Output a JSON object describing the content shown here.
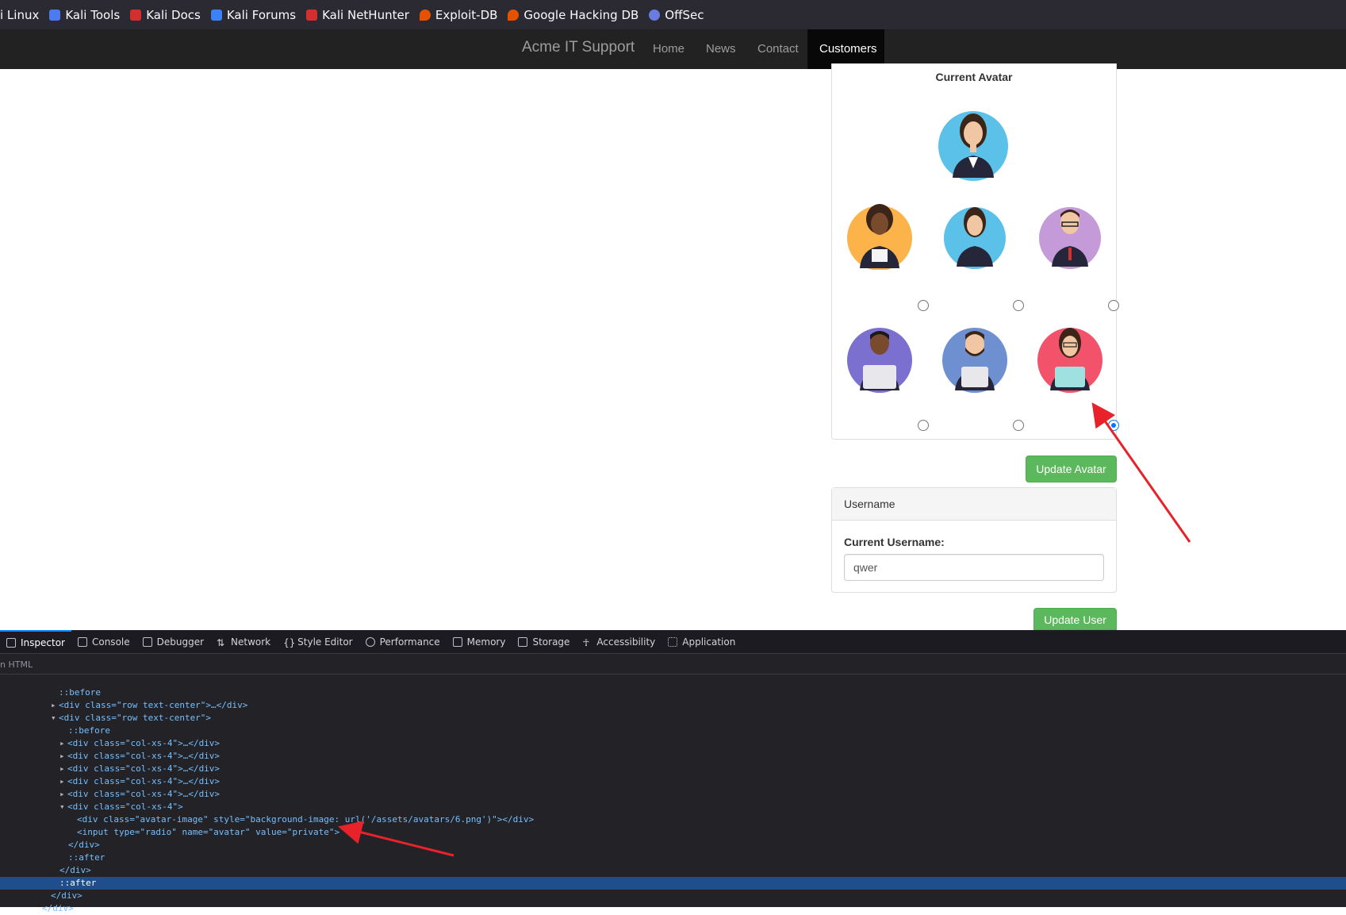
{
  "bookmarks": [
    {
      "label": "i Linux",
      "color": "#367bf0"
    },
    {
      "label": "Kali Tools",
      "color": "#4c7bf0"
    },
    {
      "label": "Kali Docs",
      "color": "#d32f2f"
    },
    {
      "label": "Kali Forums",
      "color": "#3b82f6"
    },
    {
      "label": "Kali NetHunter",
      "color": "#d32f2f"
    },
    {
      "label": "Exploit-DB",
      "color": "#e65100"
    },
    {
      "label": "Google Hacking DB",
      "color": "#e65100"
    },
    {
      "label": "OffSec",
      "color": "#6a7ce0"
    }
  ],
  "navbar": {
    "brand": "Acme IT Support",
    "items": [
      "Home",
      "News",
      "Contact",
      "Customers"
    ],
    "active": "Customers"
  },
  "avatar_panel": {
    "title": "Current Avatar",
    "selected_index": 5,
    "avatars": [
      {
        "bg": "#fbb34a",
        "desc": "woman-curly-hair"
      },
      {
        "bg": "#5cc1e8",
        "desc": "woman-phone"
      },
      {
        "bg": "#c59ad8",
        "desc": "man-glasses"
      },
      {
        "bg": "#7b6fd0",
        "desc": "man-laptop"
      },
      {
        "bg": "#6e8fd0",
        "desc": "man-beard-laptop"
      },
      {
        "bg": "#f2526a",
        "desc": "woman-glasses-laptop"
      }
    ],
    "current_bg": "#5cc1e8",
    "update_button": "Update Avatar"
  },
  "username_panel": {
    "heading": "Username",
    "label": "Current Username:",
    "value": "qwer",
    "update_button": "Update User"
  },
  "devtools": {
    "tabs": [
      "Inspector",
      "Console",
      "Debugger",
      "Network",
      "Style Editor",
      "Performance",
      "Memory",
      "Storage",
      "Accessibility",
      "Application"
    ],
    "selected_tab": "Inspector",
    "search_placeholder": "n HTML",
    "lines": [
      {
        "text": "::before"
      },
      {
        "text": "<div class=\"row text-center\">…</div>"
      },
      {
        "text": "<div class=\"row text-center\">"
      },
      {
        "text": "::before"
      },
      {
        "text": "<div class=\"col-xs-4\">…</div>"
      },
      {
        "text": "<div class=\"col-xs-4\">…</div>"
      },
      {
        "text": "<div class=\"col-xs-4\">…</div>"
      },
      {
        "text": "<div class=\"col-xs-4\">…</div>"
      },
      {
        "text": "<div class=\"col-xs-4\">…</div>"
      },
      {
        "text": "<div class=\"col-xs-4\">"
      },
      {
        "text": "<div class=\"avatar-image\" style=\"background-image: url('/assets/avatars/6.png')\"></div>"
      },
      {
        "text": "<input type=\"radio\" name=\"avatar\" value=\"private\">"
      },
      {
        "text": "</div>"
      },
      {
        "text": "::after"
      },
      {
        "text": "</div>"
      },
      {
        "text": "::after"
      },
      {
        "text": "</div>"
      },
      {
        "text": "</div>"
      }
    ]
  },
  "colors": {
    "annotation_arrow": "#e8222a",
    "accent_green": "#5cb85c"
  }
}
